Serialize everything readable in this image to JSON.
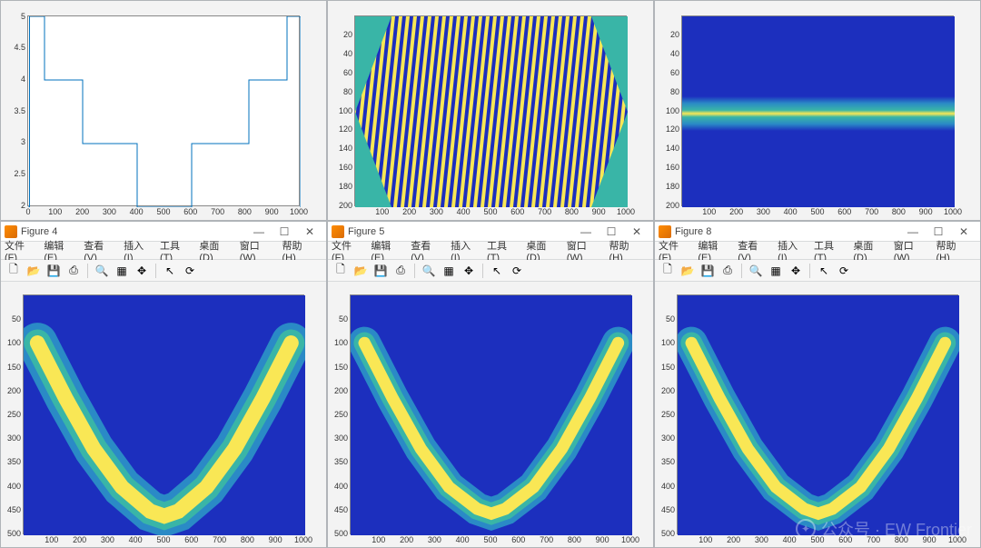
{
  "watermark": "公众号 · EW Frontier",
  "watermark_icon_name": "wechat-icon",
  "top_row": {
    "chart1": {
      "xticks": [
        0,
        100,
        200,
        300,
        400,
        500,
        600,
        700,
        800,
        900,
        1000
      ],
      "yticks": [
        2,
        2.5,
        3,
        3.5,
        4,
        4.5,
        5
      ]
    },
    "chart2": {
      "xticks": [
        100,
        200,
        300,
        400,
        500,
        600,
        700,
        800,
        900,
        1000
      ],
      "yticks": [
        20,
        40,
        60,
        80,
        100,
        120,
        140,
        160,
        180,
        200
      ]
    },
    "chart3": {
      "xticks": [
        100,
        200,
        300,
        400,
        500,
        600,
        700,
        800,
        900,
        1000
      ],
      "yticks": [
        20,
        40,
        60,
        80,
        100,
        120,
        140,
        160,
        180,
        200
      ]
    }
  },
  "figure_windows": [
    {
      "title": "Figure 4",
      "menu": [
        "文件(F)",
        "编辑(E)",
        "查看(V)",
        "插入(I)",
        "工具(T)",
        "桌面(D)",
        "窗口(W)",
        "帮助(H)"
      ],
      "xticks": [
        100,
        200,
        300,
        400,
        500,
        600,
        700,
        800,
        900,
        1000
      ],
      "yticks": [
        50,
        100,
        150,
        200,
        250,
        300,
        350,
        400,
        450,
        500
      ]
    },
    {
      "title": "Figure 5",
      "menu": [
        "文件(F)",
        "编辑(E)",
        "查看(V)",
        "插入(I)",
        "工具(T)",
        "桌面(D)",
        "窗口(W)",
        "帮助(H)"
      ],
      "xticks": [
        100,
        200,
        300,
        400,
        500,
        600,
        700,
        800,
        900,
        1000
      ],
      "yticks": [
        50,
        100,
        150,
        200,
        250,
        300,
        350,
        400,
        450,
        500
      ]
    },
    {
      "title": "Figure 8",
      "menu": [
        "文件(F)",
        "编辑(E)",
        "查看(V)",
        "插入(I)",
        "工具(T)",
        "桌面(D)",
        "窗口(W)",
        "帮助(H)"
      ],
      "xticks": [
        100,
        200,
        300,
        400,
        500,
        600,
        700,
        800,
        900,
        1000
      ],
      "yticks": [
        50,
        100,
        150,
        200,
        250,
        300,
        350,
        400,
        450,
        500
      ]
    }
  ],
  "chart_data": [
    {
      "type": "line",
      "title": "",
      "xlabel": "",
      "ylabel": "",
      "xlim": [
        0,
        1000
      ],
      "ylim": [
        2,
        5
      ],
      "x": [
        0,
        5,
        5,
        60,
        60,
        200,
        200,
        400,
        400,
        600,
        600,
        810,
        810,
        950,
        950,
        1000,
        1000,
        1000
      ],
      "y": [
        2,
        2,
        5,
        5,
        4,
        4,
        3,
        3,
        2,
        2,
        3,
        3,
        4,
        4,
        5,
        5,
        2,
        2
      ]
    },
    {
      "type": "heatmap",
      "title": "",
      "xlabel": "",
      "ylabel": "",
      "xlim": [
        1,
        1000
      ],
      "ylim": [
        1,
        200
      ],
      "note": "dense interference / chirp fringe pattern, not enumerable from pixels",
      "colormap": "parula"
    },
    {
      "type": "heatmap",
      "title": "",
      "xlabel": "",
      "ylabel": "",
      "xlim": [
        1,
        1000
      ],
      "ylim": [
        1,
        200
      ],
      "note": "horizontal bright band centered near y≈100, width≈30",
      "band_center_y": 100,
      "band_halfwidth": 15,
      "colormap": "parula"
    },
    {
      "type": "heatmap",
      "title": "",
      "xlabel": "",
      "ylabel": "",
      "xlim": [
        1,
        1000
      ],
      "ylim": [
        1,
        500
      ],
      "note": "U-shaped bright band; minimum near x≈500 at y≈460; reaches y≈100 at x≈50 and x≈950",
      "curve_samples": {
        "x": [
          50,
          150,
          250,
          350,
          450,
          500,
          550,
          650,
          750,
          850,
          950
        ],
        "y": [
          100,
          215,
          320,
          400,
          450,
          460,
          450,
          400,
          320,
          215,
          100
        ]
      },
      "band_halfwidth": 35,
      "colormap": "parula"
    },
    {
      "type": "heatmap",
      "title": "",
      "xlabel": "",
      "ylabel": "",
      "xlim": [
        1,
        1000
      ],
      "ylim": [
        1,
        500
      ],
      "curve_samples": {
        "x": [
          50,
          150,
          250,
          350,
          450,
          500,
          550,
          650,
          750,
          850,
          950
        ],
        "y": [
          100,
          215,
          320,
          400,
          445,
          455,
          445,
          400,
          320,
          215,
          100
        ]
      },
      "band_halfwidth": 28,
      "colormap": "parula"
    },
    {
      "type": "heatmap",
      "title": "",
      "xlabel": "",
      "ylabel": "",
      "xlim": [
        1,
        1000
      ],
      "ylim": [
        1,
        500
      ],
      "curve_samples": {
        "x": [
          50,
          150,
          250,
          350,
          450,
          500,
          550,
          650,
          750,
          850,
          950
        ],
        "y": [
          100,
          215,
          320,
          400,
          445,
          455,
          445,
          400,
          320,
          215,
          100
        ]
      },
      "band_halfwidth": 28,
      "colormap": "parula"
    }
  ],
  "colors": {
    "deep_blue": "#1c2fbe",
    "teal": "#39b5a7",
    "yellow": "#f9e755",
    "orange": "#f5a623",
    "line_blue": "#0072bd"
  },
  "win_controls": {
    "min": "—",
    "max": "☐",
    "close": "✕"
  }
}
